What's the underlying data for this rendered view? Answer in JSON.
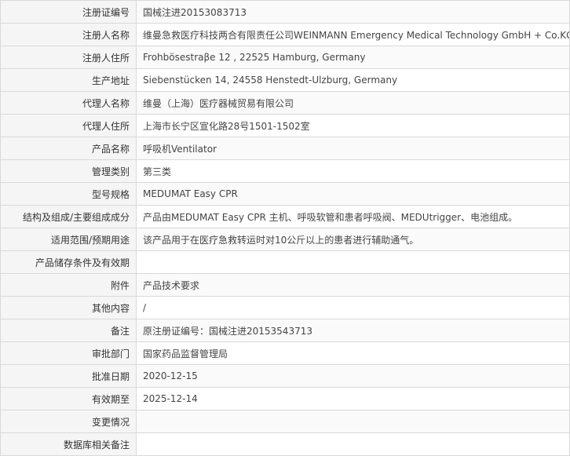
{
  "rows": [
    {
      "label": "注册证编号",
      "value": "国械注进20153083713"
    },
    {
      "label": "注册人名称",
      "value": "维曼急救医疗科技两合有限责任公司WEINMANN Emergency Medical Technology GmbH + Co.KG"
    },
    {
      "label": "注册人住所",
      "value": "Frohbösestraβe 12 , 22525 Hamburg, Germany"
    },
    {
      "label": "生产地址",
      "value": "Siebenstücken 14, 24558 Henstedt-Ulzburg, Germany"
    },
    {
      "label": "代理人名称",
      "value": "维曼（上海）医疗器械贸易有限公司"
    },
    {
      "label": "代理人住所",
      "value": "上海市长宁区宣化路28号1501-1502室"
    },
    {
      "label": "产品名称",
      "value": "呼吸机Ventilator"
    },
    {
      "label": "管理类别",
      "value": "第三类"
    },
    {
      "label": "型号规格",
      "value": "MEDUMAT Easy CPR"
    },
    {
      "label": "结构及组成/主要组成成分",
      "value": "产品由MEDUMAT Easy CPR 主机、呼吸软管和患者呼吸阀、MEDUtrigger、电池组成。"
    },
    {
      "label": "适用范围/预期用途",
      "value": "该产品用于在医疗急救转运时对10公斤以上的患者进行辅助通气。"
    },
    {
      "label": "产品储存条件及有效期",
      "value": ""
    },
    {
      "label": "附件",
      "value": "产品技术要求"
    },
    {
      "label": "其他内容",
      "value": "/"
    },
    {
      "label": "备注",
      "value": "原注册证编号：国械注进20153543713"
    },
    {
      "label": "审批部门",
      "value": "国家药品监督管理局"
    },
    {
      "label": "批准日期",
      "value": "2020-12-15"
    },
    {
      "label": "有效期至",
      "value": "2025-12-14"
    },
    {
      "label": "变更情况",
      "value": ""
    },
    {
      "label": "数据库相关备注",
      "value": ""
    }
  ]
}
